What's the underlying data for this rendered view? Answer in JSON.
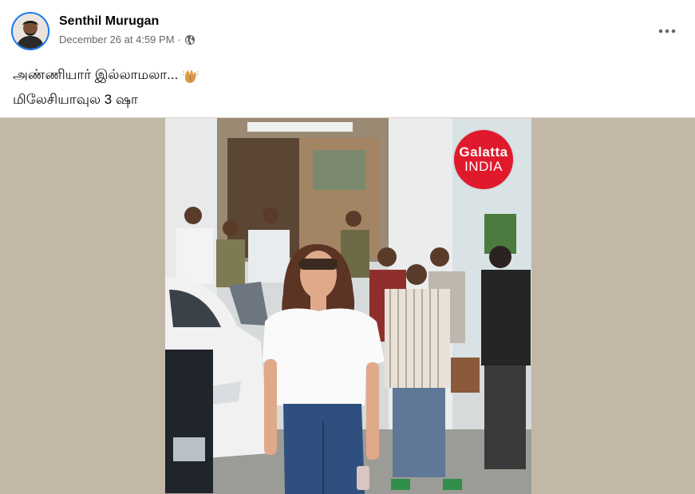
{
  "post": {
    "author": "Senthil Murugan",
    "timestamp": "December 26 at 4:59 PM",
    "separator": "·",
    "privacy_icon": "globe-icon",
    "more_icon": "more-horizontal-icon",
    "more_glyph": "•••",
    "caption_line1": "அண்ணியார் இல்லாமலா...",
    "caption_emoji": "hands-emoji",
    "caption_line2": "மிலேசியாவுல 3 ஷா"
  },
  "media": {
    "type": "video-thumbnail",
    "logo_line1": "Galatta",
    "logo_line2": "INDIA",
    "colors": {
      "backdrop": "#c3b8a8",
      "logo_red": "#e0192c"
    }
  },
  "colors": {
    "author_text": "#050505",
    "meta_text": "#65676b",
    "avatar_ring": "#1877f2"
  }
}
